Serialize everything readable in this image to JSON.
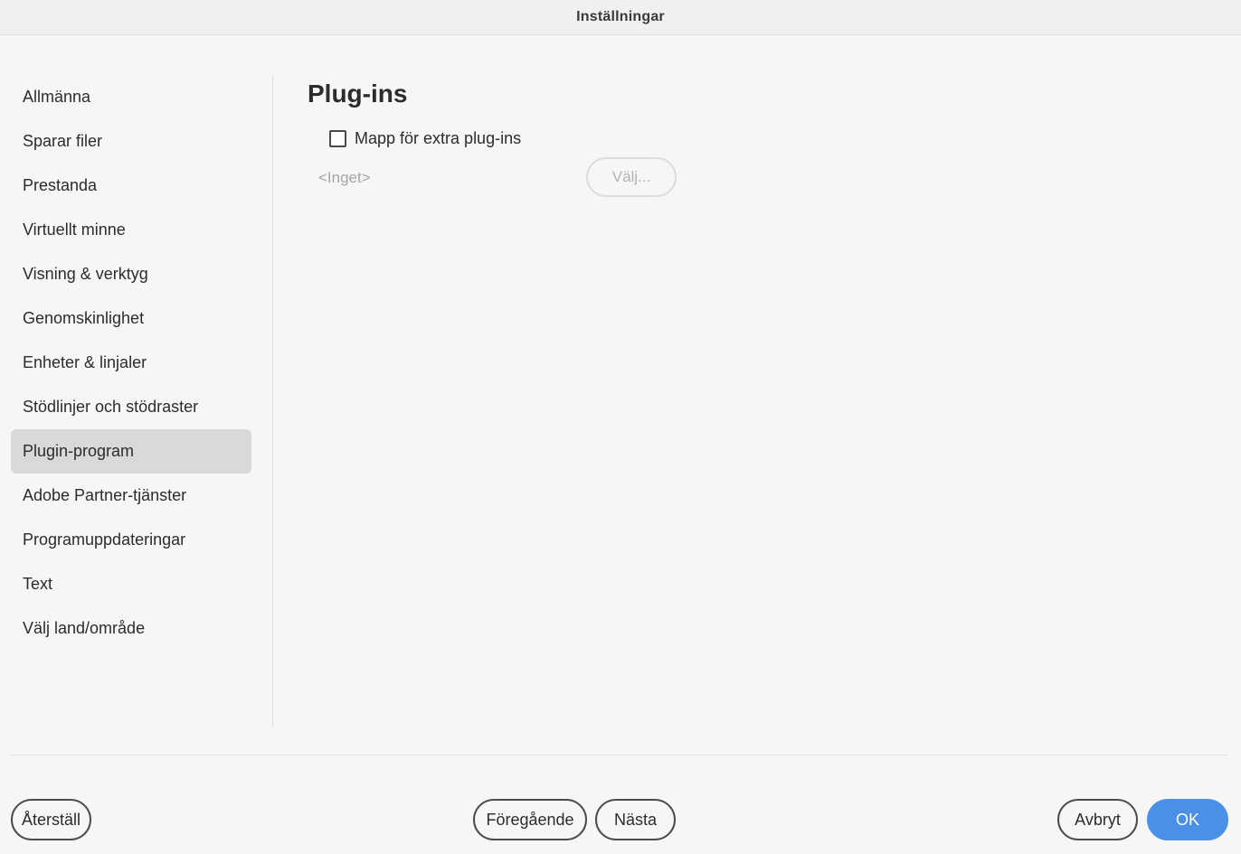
{
  "window": {
    "title": "Inställningar"
  },
  "sidebar": {
    "items": [
      {
        "label": "Allmänna"
      },
      {
        "label": "Sparar filer"
      },
      {
        "label": "Prestanda"
      },
      {
        "label": "Virtuellt minne"
      },
      {
        "label": "Visning & verktyg"
      },
      {
        "label": "Genomskinlighet"
      },
      {
        "label": "Enheter & linjaler"
      },
      {
        "label": "Stödlinjer och stödraster"
      },
      {
        "label": "Plugin-program",
        "selected": true
      },
      {
        "label": "Adobe Partner-tjänster"
      },
      {
        "label": "Programuppdateringar"
      },
      {
        "label": "Text"
      },
      {
        "label": "Välj land/område"
      }
    ]
  },
  "main": {
    "section_title": "Plug-ins",
    "extra_plugins_checkbox": {
      "label": "Mapp för extra plug-ins",
      "checked": false
    },
    "folder_path": "<Inget>",
    "choose_button": "Välj...",
    "choose_enabled": false
  },
  "footer": {
    "reset": "Återställ",
    "previous": "Föregående",
    "next": "Nästa",
    "cancel": "Avbryt",
    "ok": "OK"
  },
  "colors": {
    "accent": "#4a90e8",
    "selected_item_bg": "#d9d9d9",
    "background": "#f6f6f6"
  }
}
